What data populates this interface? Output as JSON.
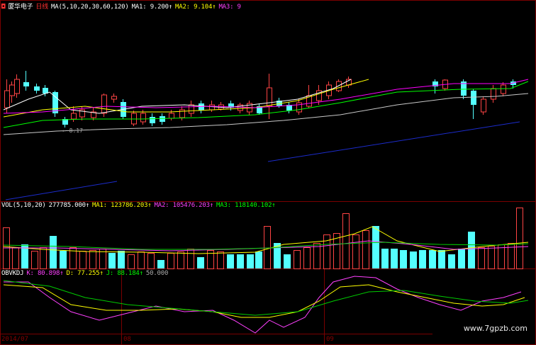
{
  "header": {
    "stock_name": "厦华电子",
    "period": "日线",
    "ma_params": "MA(5,10,20,30,60,120)",
    "ma1": "MA1: 9.200↑",
    "ma2": "MA2: 9.104↑",
    "ma3": "MA3: 9"
  },
  "volume_header": {
    "title": "VOL(5,10,20)",
    "value": "277785.000↑",
    "ma1": "MA1: 123786.203↑",
    "ma2": "MA2: 105476.203↑",
    "ma3": "MA3: 118140.102↑"
  },
  "kdj_header": {
    "title": "OBVKDJ",
    "k": "K: 80.898↑",
    "d": "D: 77.255↑",
    "j": "J: 88.184↑",
    "level": "50.000"
  },
  "price_marker": "← 8.17",
  "dates": {
    "start": "2014/07",
    "aug": "08",
    "sep": "09"
  },
  "watermark": "www.7gpzb.com",
  "colors": {
    "up": "#ff4444",
    "down": "#54ffff",
    "ma1": "#ffffff",
    "ma2": "#ffff00",
    "ma3": "#ff00ff",
    "ma4": "#00ff00",
    "ma5": "#c8c8c8",
    "trend": "#1c2ccc",
    "k": "#ff40ff",
    "d": "#ffff00",
    "j": "#00cc00"
  }
}
